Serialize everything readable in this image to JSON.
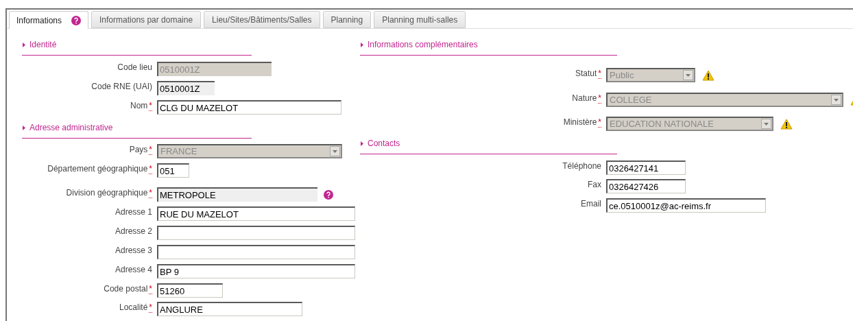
{
  "tabs": [
    {
      "label": "Informations",
      "selected": true,
      "help": true
    },
    {
      "label": "Informations par domaine",
      "selected": false
    },
    {
      "label": "Lieu/Sites/Bâtiments/Salles",
      "selected": false
    },
    {
      "label": "Planning",
      "selected": false
    },
    {
      "label": "Planning multi-salles",
      "selected": false
    }
  ],
  "left": [
    {
      "title": "Identité",
      "fields": [
        {
          "label": "Code lieu",
          "kind": "readonly",
          "value": "0510001Z"
        },
        {
          "label": "Code RNE (UAI)",
          "kind": "locked",
          "value": "0510001Z"
        },
        {
          "label": "Nom",
          "required": "*",
          "kind": "text",
          "value": "CLG DU MAZELOT"
        }
      ]
    },
    {
      "title": "Adresse administrative",
      "fields": [
        {
          "label": "Pays",
          "required": "*",
          "kind": "select",
          "value": "FRANCE"
        },
        {
          "label": "Département géographique",
          "required": "*",
          "kind": "text",
          "value": "051"
        },
        {
          "label": "Division géographique",
          "required": "*",
          "kind": "locked",
          "value": "METROPOLE",
          "help": true
        },
        {
          "label": "Adresse 1",
          "kind": "text",
          "value": "RUE DU MAZELOT"
        },
        {
          "label": "Adresse 2",
          "kind": "text"
        },
        {
          "label": "Adresse 3",
          "kind": "text"
        },
        {
          "label": "Adresse 4",
          "kind": "text",
          "value": "BP 9"
        },
        {
          "label": "Code postal",
          "required": "*",
          "kind": "text",
          "value": "51260"
        },
        {
          "label": "Localité",
          "required": "*",
          "kind": "text",
          "value": "ANGLURE"
        }
      ]
    }
  ],
  "right": [
    {
      "title": "Informations complémentaires",
      "fields": [
        {
          "label": "Statut",
          "required": "*",
          "kind": "select",
          "value": "Public",
          "warning": true
        },
        {
          "label": "Nature",
          "required": "*",
          "kind": "select",
          "value": "COLLEGE",
          "warning": true
        },
        {
          "label": "Ministère",
          "required": "*",
          "kind": "select",
          "value": "EDUCATION NATIONALE",
          "warning": true
        }
      ]
    },
    {
      "title": "Contacts",
      "fields": [
        {
          "label": "Téléphone",
          "kind": "text",
          "value": "0326427141"
        },
        {
          "label": "Fax",
          "kind": "text",
          "value": "0326427426"
        },
        {
          "label": "Email",
          "kind": "text",
          "value": "ce.0510001z@ac-reims.fr"
        }
      ]
    }
  ]
}
